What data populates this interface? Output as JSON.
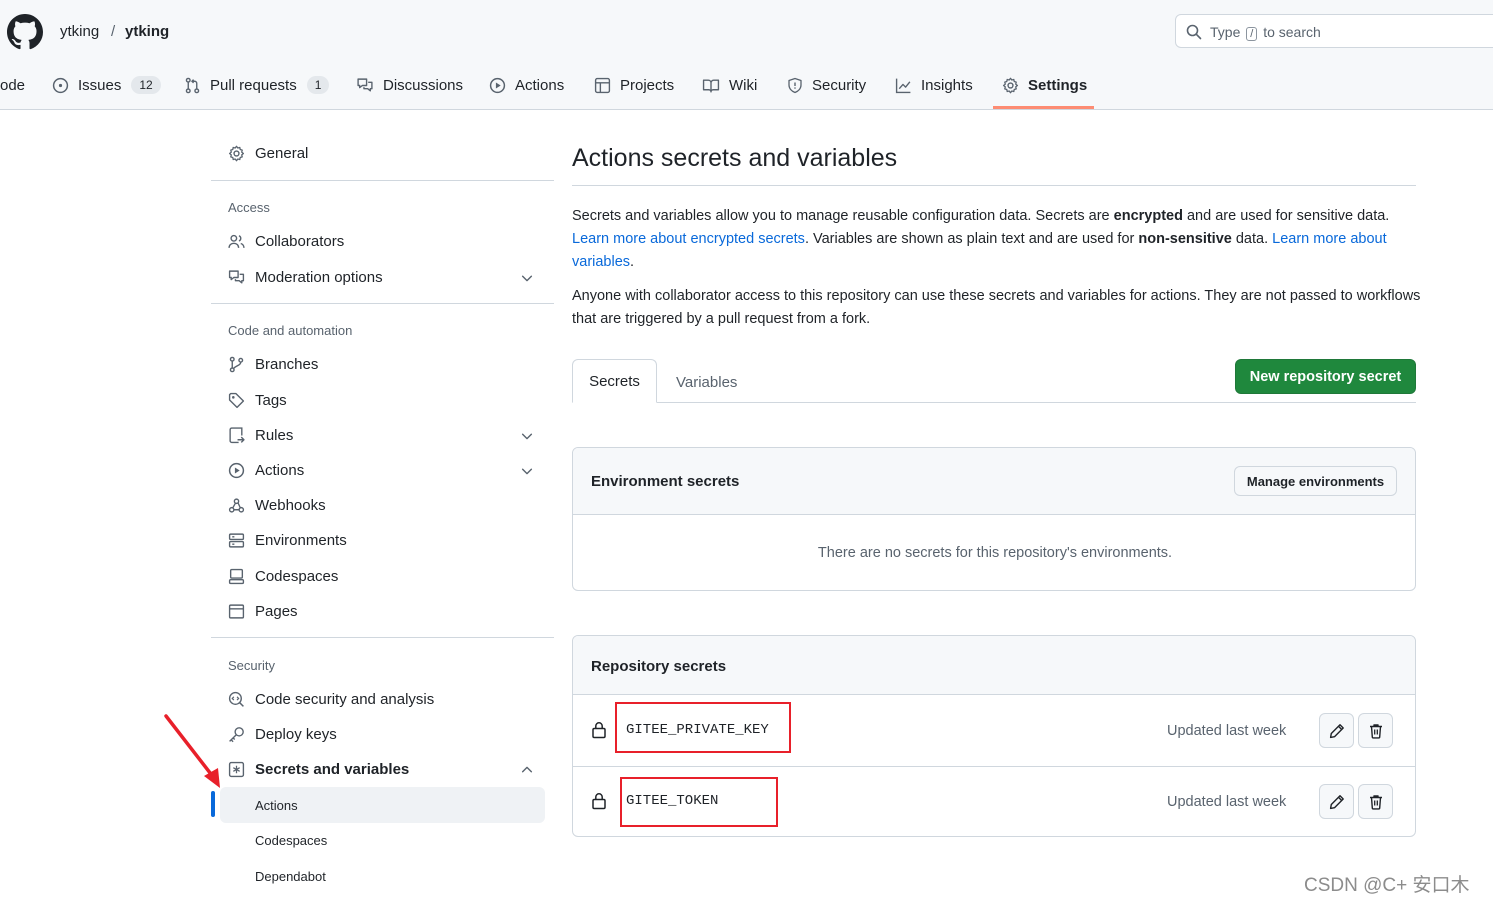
{
  "header": {
    "owner": "ytking",
    "separator": "/",
    "repo": "ytking",
    "search": {
      "prefix": "Type",
      "key": "/",
      "suffix": "to search"
    }
  },
  "repo_tabs": [
    {
      "label": "ode",
      "icon": "code-icon"
    },
    {
      "label": "Issues",
      "count": "12",
      "icon": "issue-opened-icon"
    },
    {
      "label": "Pull requests",
      "count": "1",
      "icon": "git-pull-request-icon"
    },
    {
      "label": "Discussions",
      "icon": "comment-discussion-icon"
    },
    {
      "label": "Actions",
      "icon": "play-icon"
    },
    {
      "label": "Projects",
      "icon": "table-icon"
    },
    {
      "label": "Wiki",
      "icon": "book-icon"
    },
    {
      "label": "Security",
      "icon": "shield-icon"
    },
    {
      "label": "Insights",
      "icon": "graph-icon"
    },
    {
      "label": "Settings",
      "icon": "gear-icon",
      "selected": true
    }
  ],
  "sidebar": {
    "general": "General",
    "access_heading": "Access",
    "access_items": [
      "Collaborators",
      "Moderation options"
    ],
    "code_heading": "Code and automation",
    "code_items": [
      "Branches",
      "Tags",
      "Rules",
      "Actions",
      "Webhooks",
      "Environments",
      "Codespaces",
      "Pages"
    ],
    "security_heading": "Security",
    "security_items": [
      "Code security and analysis",
      "Deploy keys",
      "Secrets and variables"
    ],
    "sub_items": [
      "Actions",
      "Codespaces",
      "Dependabot"
    ]
  },
  "main": {
    "title": "Actions secrets and variables",
    "intro": {
      "t1": "Secrets and variables allow you to manage reusable configuration data. Secrets are ",
      "b1": "encrypted",
      "t2": " and are used for sensitive data. ",
      "link1": "Learn more about encrypted secrets",
      "t3": ". Variables are shown as plain text and are used for ",
      "b2": "non-sensitive",
      "t4": " data. ",
      "link2": "Learn more about variables",
      "t5": "."
    },
    "notice": "Anyone with collaborator access to this repository can use these secrets and variables for actions. They are not passed to workflows that are triggered by a pull request from a fork.",
    "tabs": [
      "Secrets",
      "Variables"
    ],
    "new_secret_button": "New repository secret",
    "env_secrets": {
      "title": "Environment secrets",
      "manage_button": "Manage environments",
      "empty": "There are no secrets for this repository's environments."
    },
    "repo_secrets": {
      "title": "Repository secrets",
      "rows": [
        {
          "name": "GITEE_PRIVATE_KEY",
          "updated": "Updated last week"
        },
        {
          "name": "GITEE_TOKEN",
          "updated": "Updated last week"
        }
      ]
    }
  },
  "watermark": "CSDN @C+   安口木",
  "colors": {
    "accent": "#1f883d",
    "link": "#0969da",
    "tab_underline": "#fd8c73",
    "annotation": "#e8202a"
  }
}
